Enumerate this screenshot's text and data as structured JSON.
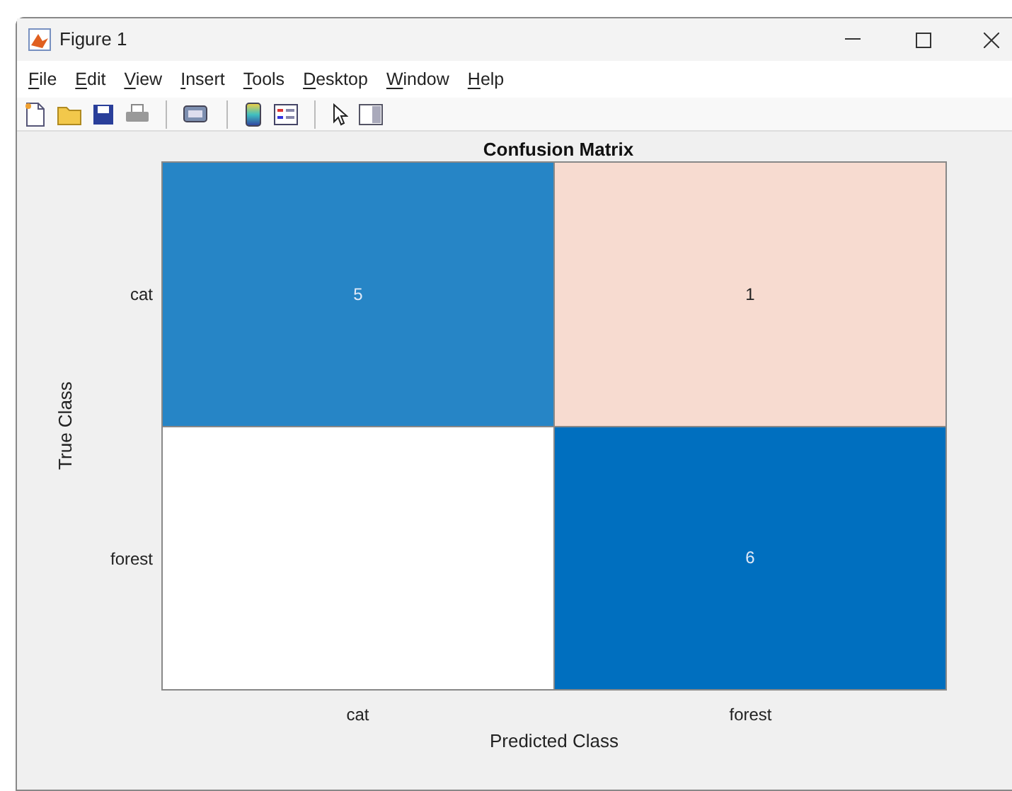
{
  "window": {
    "title": "Figure 1"
  },
  "menu": [
    {
      "label": "File",
      "accelerator_underlined": true
    },
    {
      "label": "Edit",
      "accelerator_underlined": true
    },
    {
      "label": "View",
      "accelerator_underlined": true
    },
    {
      "label": "Insert",
      "accelerator_underlined": true
    },
    {
      "label": "Tools",
      "accelerator_underlined": true
    },
    {
      "label": "Desktop",
      "accelerator_underlined": true
    },
    {
      "label": "Window",
      "accelerator_underlined": true
    },
    {
      "label": "Help",
      "accelerator_underlined": true
    }
  ],
  "toolbar": [
    {
      "kind": "new"
    },
    {
      "kind": "open"
    },
    {
      "kind": "save"
    },
    {
      "kind": "print"
    },
    {
      "kind": "separator"
    },
    {
      "kind": "link"
    },
    {
      "kind": "separator"
    },
    {
      "kind": "colorbar"
    },
    {
      "kind": "legend"
    },
    {
      "kind": "separator"
    },
    {
      "kind": "pointer"
    },
    {
      "kind": "panel"
    }
  ],
  "plot": {
    "title": "Confusion Matrix",
    "ylabel": "True Class",
    "xlabel": "Predicted Class",
    "row_labels": [
      "cat",
      "forest"
    ],
    "column_labels": [
      "cat",
      "forest"
    ],
    "rows": [
      [
        {
          "value": "5",
          "color": "#2685c6"
        },
        {
          "value": "1",
          "color": "#f7dbd0"
        }
      ],
      [
        {
          "color": "#ffffff"
        },
        {
          "value": "6",
          "color": "#006fbf"
        }
      ]
    ]
  }
}
